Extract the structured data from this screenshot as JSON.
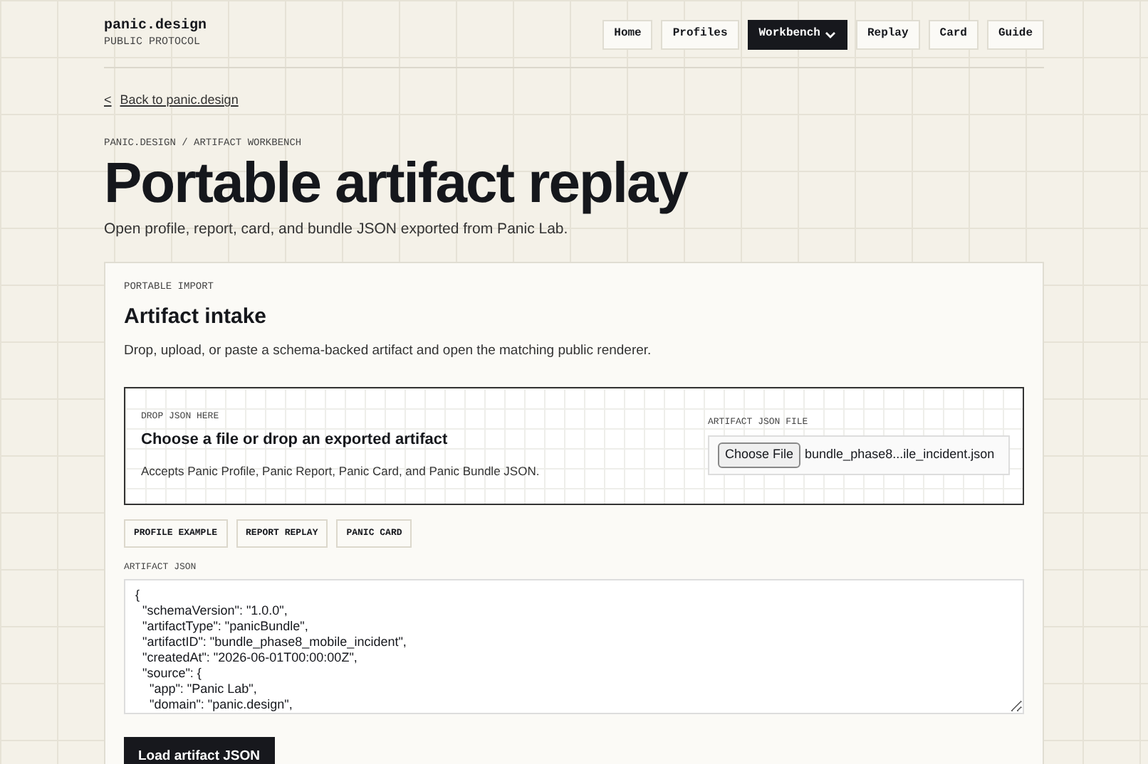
{
  "brand": {
    "name": "panic.design",
    "tagline": "PUBLIC PROTOCOL"
  },
  "nav": [
    {
      "label": "Home",
      "selected": false,
      "dropdown": false
    },
    {
      "label": "Profiles",
      "selected": false,
      "dropdown": false
    },
    {
      "label": "Workbench",
      "selected": true,
      "dropdown": true
    },
    {
      "label": "Replay",
      "selected": false,
      "dropdown": false
    },
    {
      "label": "Card",
      "selected": false,
      "dropdown": false
    },
    {
      "label": "Guide",
      "selected": false,
      "dropdown": false
    }
  ],
  "back_link": {
    "arrow": "<",
    "label": "Back to panic.design"
  },
  "breadcrumb": "PANIC.DESIGN / ARTIFACT WORKBENCH",
  "title": "Portable artifact replay",
  "subtitle": "Open profile, report, card, and bundle JSON exported from Panic Lab.",
  "card": {
    "eyebrow": "PORTABLE IMPORT",
    "heading": "Artifact intake",
    "description": "Drop, upload, or paste a schema-backed artifact and open the matching public renderer.",
    "dropzone": {
      "eyebrow": "DROP JSON HERE",
      "heading": "Choose a file or drop an exported artifact",
      "description": "Accepts Panic Profile, Panic Report, Panic Card, and Panic Bundle JSON.",
      "file_label": "ARTIFACT JSON FILE",
      "file_button": "Choose File",
      "file_name": "bundle_phase8...ile_incident.json"
    },
    "examples": [
      "PROFILE EXAMPLE",
      "REPORT REPLAY",
      "PANIC CARD"
    ],
    "json_label": "ARTIFACT JSON",
    "json_value": "{\n  \"schemaVersion\": \"1.0.0\",\n  \"artifactType\": \"panicBundle\",\n  \"artifactID\": \"bundle_phase8_mobile_incident\",\n  \"createdAt\": \"2026-06-01T00:00:00Z\",\n  \"source\": {\n    \"app\": \"Panic Lab\",\n    \"domain\": \"panic.design\",",
    "load_button": "Load artifact JSON"
  }
}
